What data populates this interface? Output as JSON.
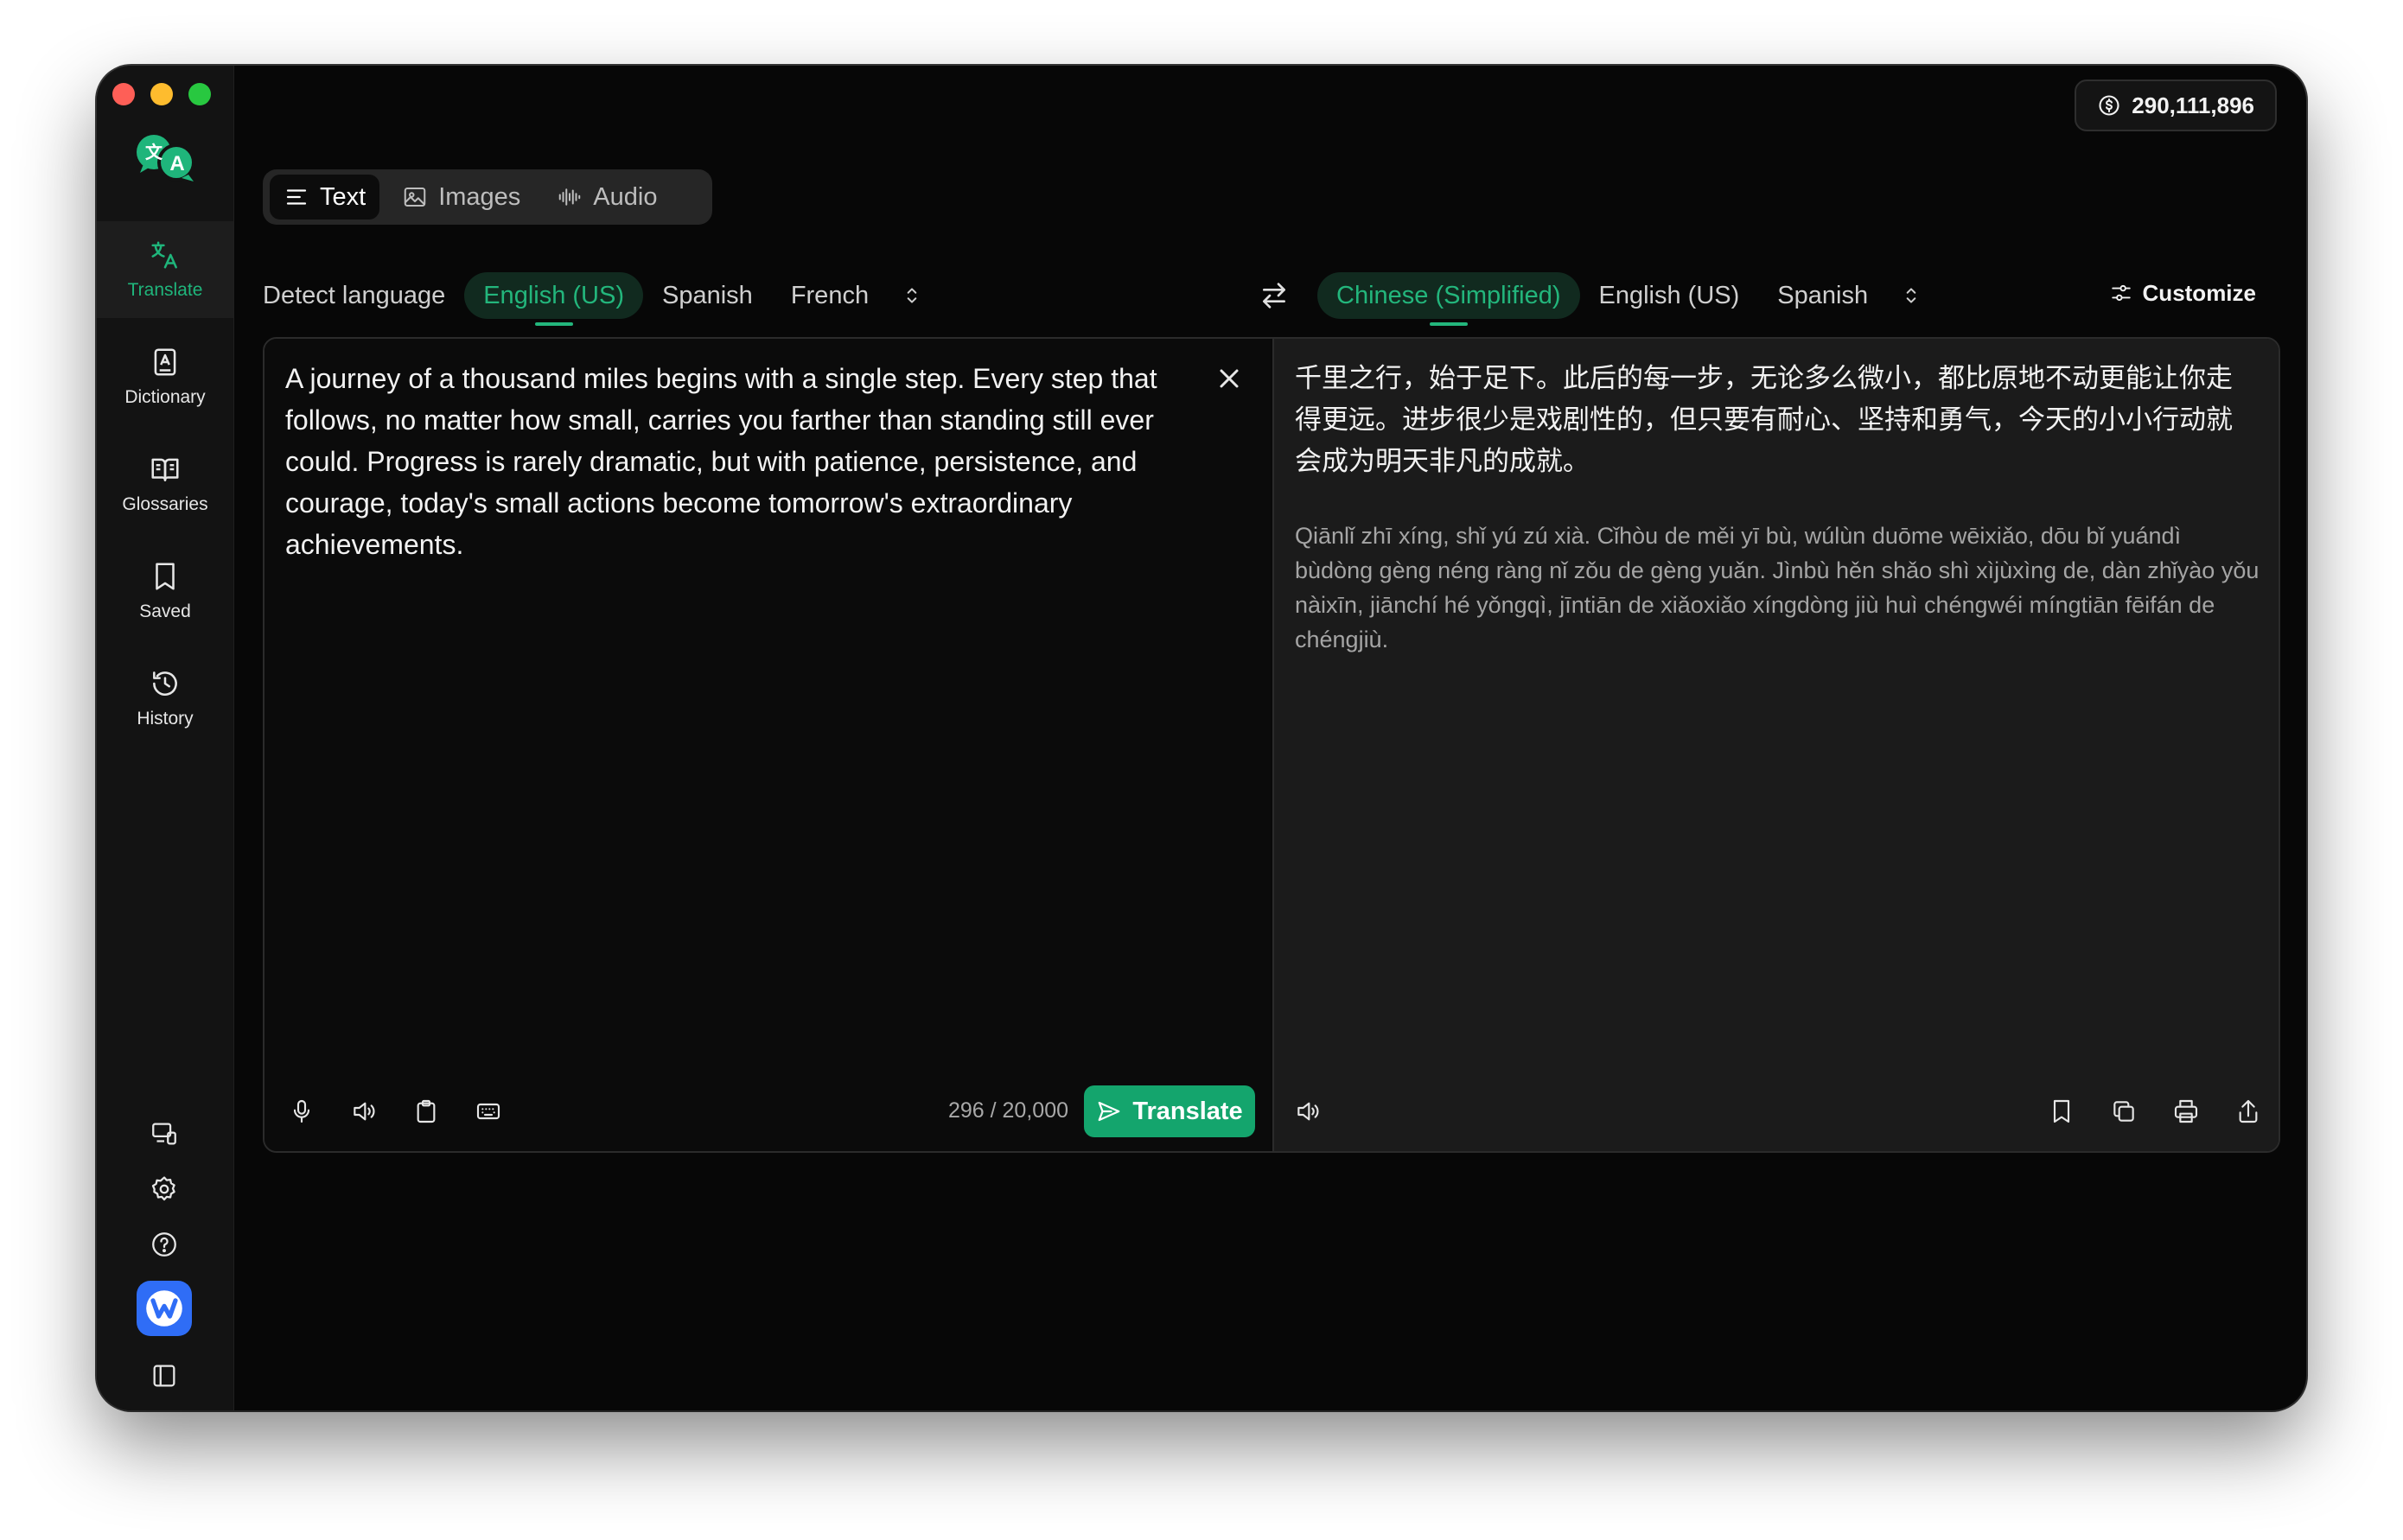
{
  "credits": {
    "amount": "290,111,896"
  },
  "sidebar": {
    "items": [
      {
        "id": "translate",
        "label": "Translate",
        "icon": "translate-icon",
        "active": true
      },
      {
        "id": "dictionary",
        "label": "Dictionary",
        "icon": "dictionary-icon",
        "active": false
      },
      {
        "id": "glossaries",
        "label": "Glossaries",
        "icon": "glossary-book-icon",
        "active": false
      },
      {
        "id": "saved",
        "label": "Saved",
        "icon": "bookmark-icon",
        "active": false
      },
      {
        "id": "history",
        "label": "History",
        "icon": "history-icon",
        "active": false
      }
    ]
  },
  "modes": [
    {
      "label": "Text",
      "icon": "text-lines-icon",
      "active": true
    },
    {
      "label": "Images",
      "icon": "image-icon",
      "active": false
    },
    {
      "label": "Audio",
      "icon": "waveform-icon",
      "active": false
    }
  ],
  "source_langs": {
    "detect": "Detect language",
    "options": [
      "English (US)",
      "Spanish",
      "French"
    ],
    "active": "English (US)"
  },
  "target_langs": {
    "options": [
      "Chinese (Simplified)",
      "English (US)",
      "Spanish"
    ],
    "active": "Chinese (Simplified)"
  },
  "customize_label": "Customize",
  "source": {
    "text": "A journey of a thousand miles begins with a single step. Every step that follows, no matter how small, carries you farther than standing still ever could. Progress is rarely dramatic, but with patience, persistence, and courage, today's small actions become tomorrow's extraordinary achievements.",
    "counter": "296 / 20,000",
    "translate_label": "Translate"
  },
  "target": {
    "text": "千里之行，始于足下。此后的每一步，无论多么微小，都比原地不动更能让你走得更远。进步很少是戏剧性的，但只要有耐心、坚持和勇气，今天的小小行动就会成为明天非凡的成就。",
    "pinyin": "Qiānlǐ zhī xíng, shǐ yú zú xià. Cǐhòu de měi yī bù, wúlùn duōme wēixiǎo, dōu bǐ yuándì bùdòng gèng néng ràng nǐ zǒu de gèng yuǎn. Jìnbù hěn shǎo shì xìjùxìng de, dàn zhǐyào yǒu nàixīn, jiānchí hé yǒngqì, jīntiān de xiǎoxiǎo xíngdòng jiù huì chéngwéi míngtiān fēifán de chéngjiù."
  },
  "colors": {
    "accent": "#23b67c",
    "button": "#14a56d",
    "background": "#070707"
  }
}
